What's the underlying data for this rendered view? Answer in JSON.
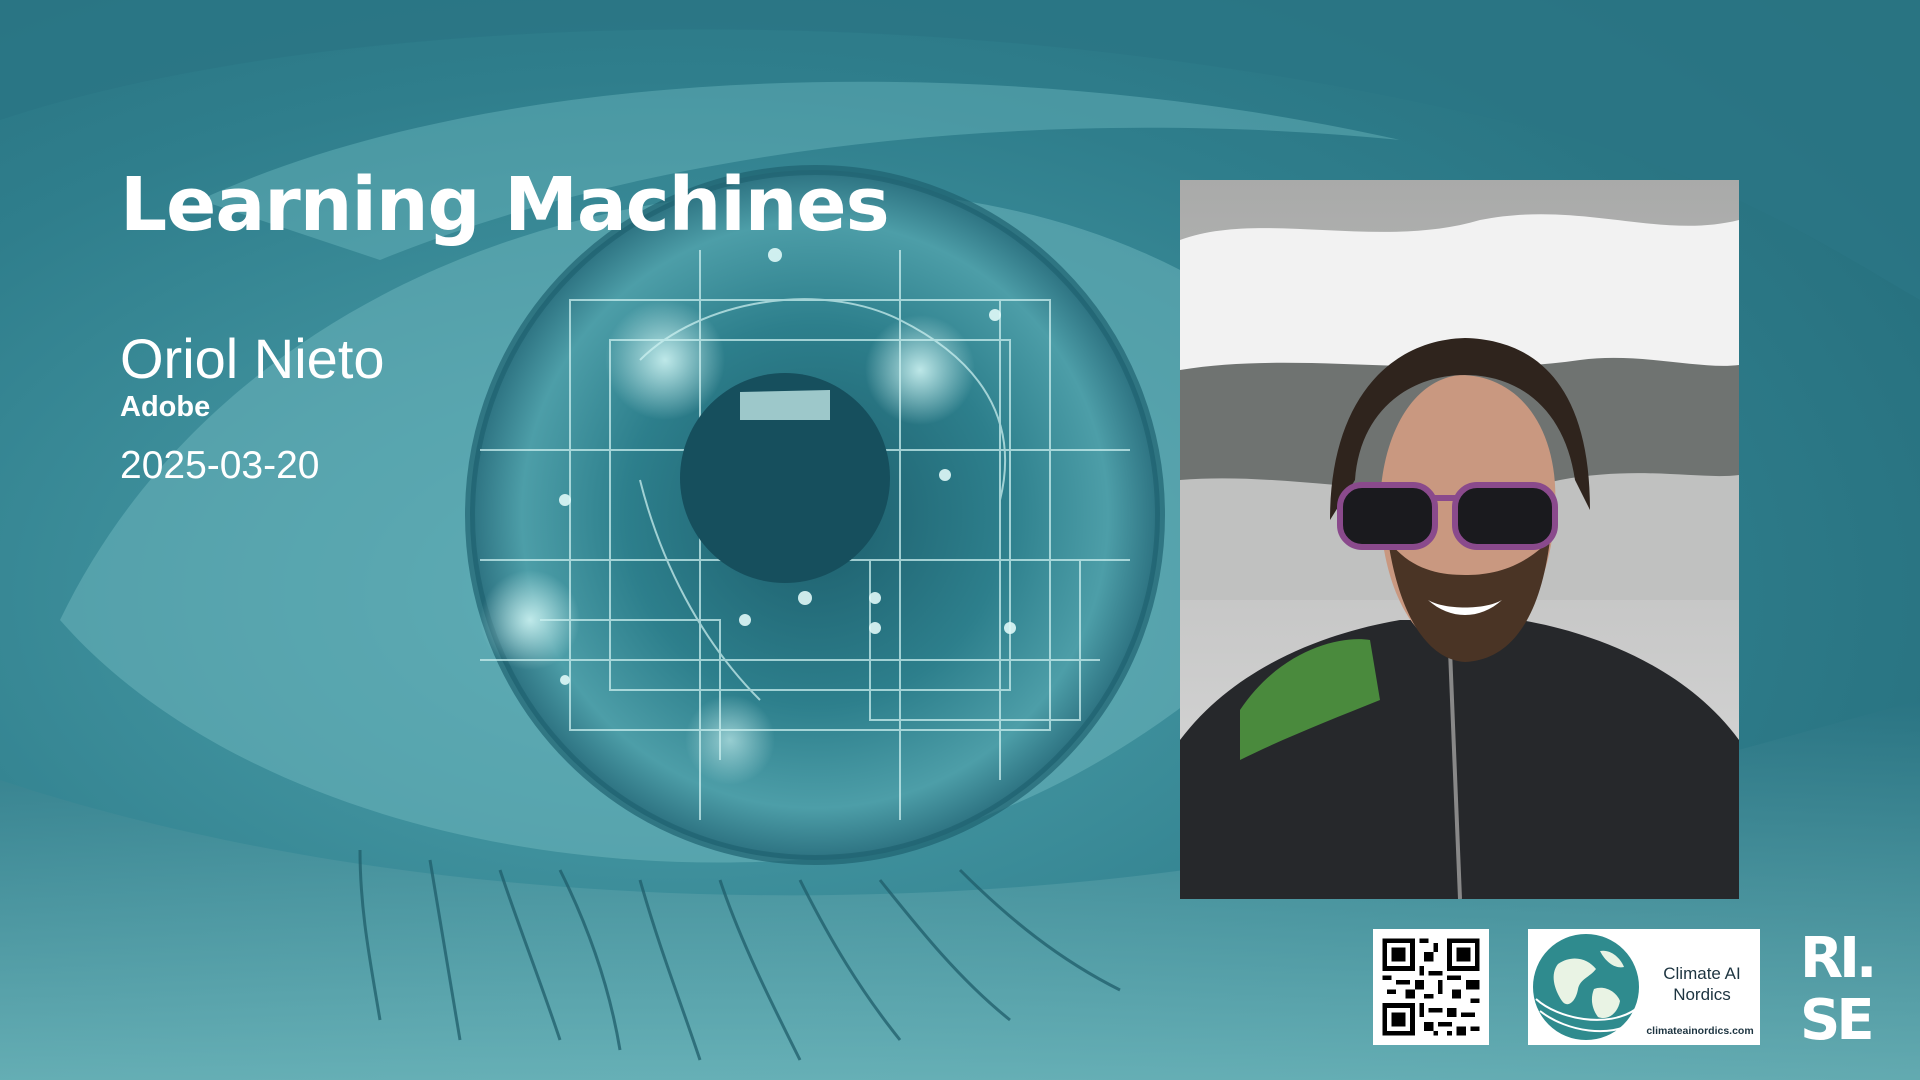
{
  "slide": {
    "title": "Learning Machines",
    "speaker": "Oriol Nieto",
    "organization": "Adobe",
    "date": "2025-03-20"
  },
  "logos": {
    "qr_code": "qr-code",
    "climate_ai": {
      "name": "Climate AI\nNordics",
      "url": "climateainordics.com"
    },
    "rise": "RI.\nSE"
  },
  "colors": {
    "background": "#3b8a99",
    "text": "#ffffff",
    "logo_dark": "#1d3440"
  },
  "background_image": "teal-eye-circuit-brain",
  "speaker_photo": "speaker-selfie-mountains"
}
